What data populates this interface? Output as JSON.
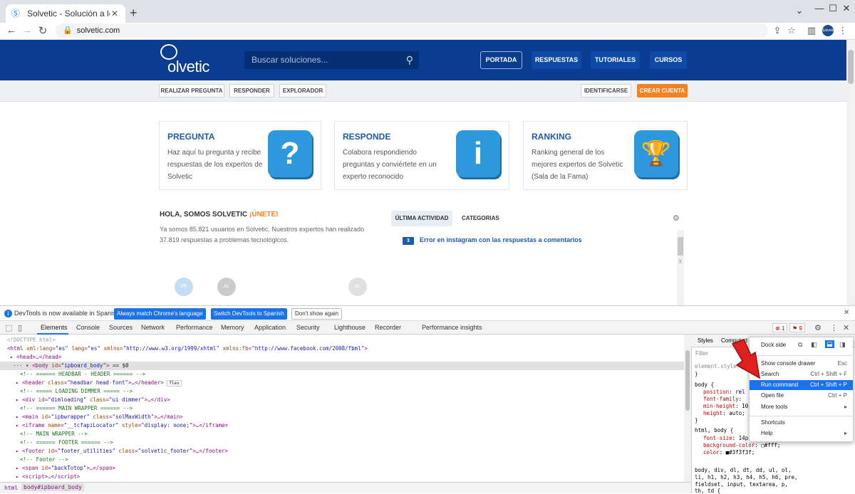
{
  "browser": {
    "tab_title": "Solvetic - Solución a los problem",
    "url": "solvetic.com",
    "new_tab": "+",
    "min": "—",
    "max": "☐",
    "close": "✕",
    "avatar_text": "Solvetic"
  },
  "site": {
    "logo": "olvetic",
    "search_placeholder": "Buscar soluciones...",
    "nav": [
      "PORTADA",
      "RESPUESTAS",
      "TUTORIALES",
      "CURSOS"
    ],
    "sub_left": [
      "REALIZAR PREGUNTA",
      "RESPONDER",
      "EXPLORADOR"
    ],
    "sub_right": [
      "IDENTIFICARSE",
      "CREAR CUENTA"
    ],
    "cards": [
      {
        "title": "PREGUNTA",
        "text": "Haz aquí tu pregunta y recibe respuestas de los expertos de Solvetic",
        "icon": "?"
      },
      {
        "title": "RESPONDE",
        "text": "Colabora respondiendo preguntas y conviértete en un experto reconocido",
        "icon": "i"
      },
      {
        "title": "RANKING",
        "text": "Ranking general de los mejores expertos de Solvetic (Sala de la Fama)",
        "icon": "🏆"
      }
    ],
    "hola": "HOLA, SOMOS SOLVETIC",
    "unete": "¡ÚNETE!",
    "hola_text": "Ya somos 85.821 usuarios en Solvetic. Nuestros expertos han realizado 37.819 respuestas a problemas tecnológicos.",
    "avatars": [
      "FR",
      "AL",
      "AL"
    ],
    "activity_tabs": [
      "ÚLTIMA ACTIVIDAD",
      "CATEGORIAS"
    ],
    "activity_badge": "3",
    "activity_item": "Error en instagram con las respuestas a comentarios"
  },
  "infobar": {
    "message": "DevTools is now available in Spanish!",
    "btn1": "Always match Chrome's language",
    "btn2": "Switch DevTools to Spanish",
    "btn3": "Don't show again"
  },
  "devtools": {
    "tabs": [
      "Elements",
      "Console",
      "Sources",
      "Network",
      "Performance",
      "Memory",
      "Application",
      "Security",
      "Lighthouse",
      "Recorder",
      "Performance insights"
    ],
    "errors": "1",
    "warnings": "9",
    "style_tabs": [
      "Styles",
      "Computed"
    ],
    "filter": "Filter",
    "breadcrumbs": [
      "html",
      "body#ipboard_body"
    ]
  },
  "menu": {
    "dock_side": "Dock side",
    "items": [
      {
        "label": "Show console drawer",
        "shortcut": "Esc"
      },
      {
        "label": "Search",
        "shortcut": "Ctrl + Shift + F"
      },
      {
        "label": "Run command",
        "shortcut": "Ctrl + Shift + P"
      },
      {
        "label": "Open file",
        "shortcut": "Ctrl + P"
      },
      {
        "label": "More tools",
        "shortcut": "▸"
      },
      {
        "label": "Shortcuts",
        "shortcut": ""
      },
      {
        "label": "Help",
        "shortcut": "▸"
      }
    ]
  },
  "colors": {
    "accent": "#1a73e8",
    "brand": "#0a3d91",
    "orange": "#f58220"
  }
}
